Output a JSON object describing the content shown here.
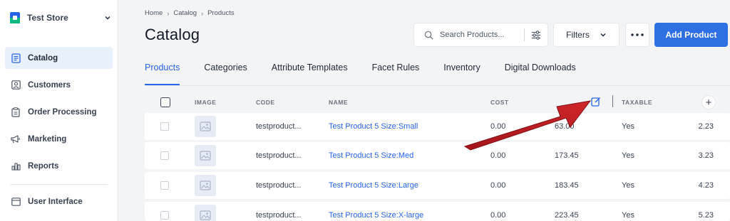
{
  "store": {
    "name": "Test Store"
  },
  "sidebar": {
    "items": [
      {
        "label": "Catalog",
        "icon": "catalog-icon",
        "active": true
      },
      {
        "label": "Customers",
        "icon": "customers-icon"
      },
      {
        "label": "Order Processing",
        "icon": "order-processing-icon"
      },
      {
        "label": "Marketing",
        "icon": "megaphone-icon"
      },
      {
        "label": "Reports",
        "icon": "bar-chart-icon"
      },
      {
        "label": "User Interface",
        "icon": "window-icon"
      }
    ]
  },
  "breadcrumb": [
    "Home",
    "Catalog",
    "Products"
  ],
  "page_title": "Catalog",
  "search": {
    "placeholder": "Search Products..."
  },
  "toolbar": {
    "filters_label": "Filters",
    "add_label": "Add Product"
  },
  "tabs": [
    "Products",
    "Categories",
    "Attribute Templates",
    "Facet Rules",
    "Inventory",
    "Digital Downloads"
  ],
  "table": {
    "headers": {
      "image": "IMAGE",
      "code": "CODE",
      "name": "NAME",
      "cost": "COST",
      "taxable": "TAXABLE"
    },
    "rows": [
      {
        "code": "testproduct...",
        "name": "Test Product 5 Size:Small",
        "cost": "0.00",
        "price": "63.00",
        "taxable": "Yes",
        "last": "2.23"
      },
      {
        "code": "testproduct...",
        "name": "Test Product 5 Size:Med",
        "cost": "0.00",
        "price": "173.45",
        "taxable": "Yes",
        "last": "3.23"
      },
      {
        "code": "testproduct...",
        "name": "Test Product 5 Size:Large",
        "cost": "0.00",
        "price": "183.45",
        "taxable": "Yes",
        "last": "4.23"
      },
      {
        "code": "testproduct...",
        "name": "Test Product 5 Size:X-large",
        "cost": "0.00",
        "price": "223.45",
        "taxable": "Yes",
        "last": "5.23"
      }
    ]
  },
  "colors": {
    "accent": "#2f6fe4",
    "link": "#2563eb",
    "active_nav_bg": "#e8f0fb",
    "annotation_arrow": "#c01f1f"
  }
}
